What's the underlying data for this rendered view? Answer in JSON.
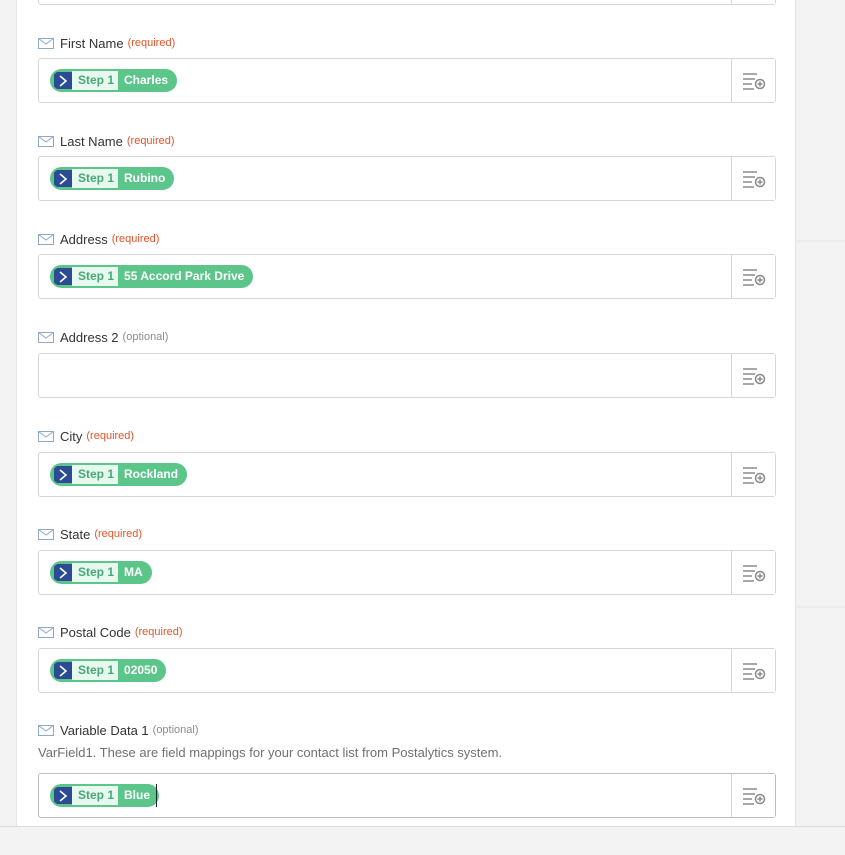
{
  "fields": [
    {
      "label": "First Name",
      "tag": "(required)",
      "tag_type": "required",
      "step": "Step 1",
      "value": "Charles"
    },
    {
      "label": "Last Name",
      "tag": "(required)",
      "tag_type": "required",
      "step": "Step 1",
      "value": "Rubino"
    },
    {
      "label": "Address",
      "tag": "(required)",
      "tag_type": "required",
      "step": "Step 1",
      "value": "55 Accord Park Drive"
    },
    {
      "label": "Address 2",
      "tag": "(optional)",
      "tag_type": "optional",
      "step": "",
      "value": ""
    },
    {
      "label": "City",
      "tag": "(required)",
      "tag_type": "required",
      "step": "Step 1",
      "value": "Rockland"
    },
    {
      "label": "State",
      "tag": "(required)",
      "tag_type": "required",
      "step": "Step 1",
      "value": "MA"
    },
    {
      "label": "Postal Code",
      "tag": "(required)",
      "tag_type": "required",
      "step": "Step 1",
      "value": "02050"
    },
    {
      "label": "Variable Data 1",
      "tag": "(optional)",
      "tag_type": "optional",
      "help": "VarField1. These are field mappings for your contact list from Postalytics system.",
      "step": "Step 1",
      "value": "Blue"
    }
  ],
  "icons": {
    "field_type": "mail-icon",
    "insert_field": "insert-field-icon",
    "app": "chevron-right-icon"
  },
  "colors": {
    "required": "#e0552b",
    "optional": "#8c8c8c",
    "pill": "#5cc58a",
    "app_icon": "#2b4b94"
  }
}
